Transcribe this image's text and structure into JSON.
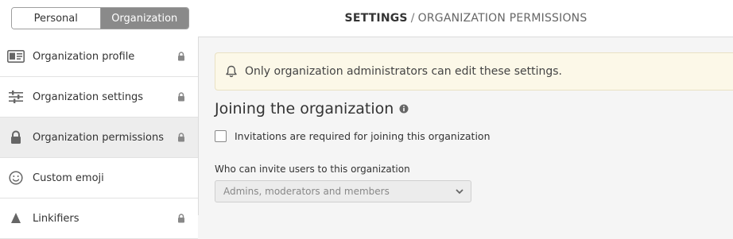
{
  "topbar": {
    "tabs": [
      "Personal",
      "Organization"
    ],
    "active_tab": "Organization",
    "breadcrumb": {
      "root": "SETTINGS",
      "separator": "/",
      "current": "ORGANIZATION PERMISSIONS"
    }
  },
  "sidebar": {
    "items": [
      {
        "label": "Organization profile",
        "icon": "id-card-icon",
        "locked": true,
        "selected": false
      },
      {
        "label": "Organization settings",
        "icon": "sliders-icon",
        "locked": true,
        "selected": false
      },
      {
        "label": "Organization permissions",
        "icon": "lock-icon",
        "locked": true,
        "selected": true
      },
      {
        "label": "Custom emoji",
        "icon": "smiley-icon",
        "locked": false,
        "selected": false
      },
      {
        "label": "Linkifiers",
        "icon": "link-icon",
        "locked": true,
        "selected": false
      }
    ]
  },
  "main": {
    "alert": {
      "icon": "bell-icon",
      "text": "Only organization administrators can edit these settings."
    },
    "section_title": "Joining the organization",
    "invitation_checkbox": {
      "label": "Invitations are required for joining this organization",
      "checked": false
    },
    "invite_field": {
      "label": "Who can invite users to this organization",
      "selected_value": "Admins, moderators and members"
    }
  },
  "colors": {
    "active_tab_bg": "#8a8a8a",
    "alert_bg": "#fcf8e8",
    "selected_item_bg": "#ededed"
  }
}
